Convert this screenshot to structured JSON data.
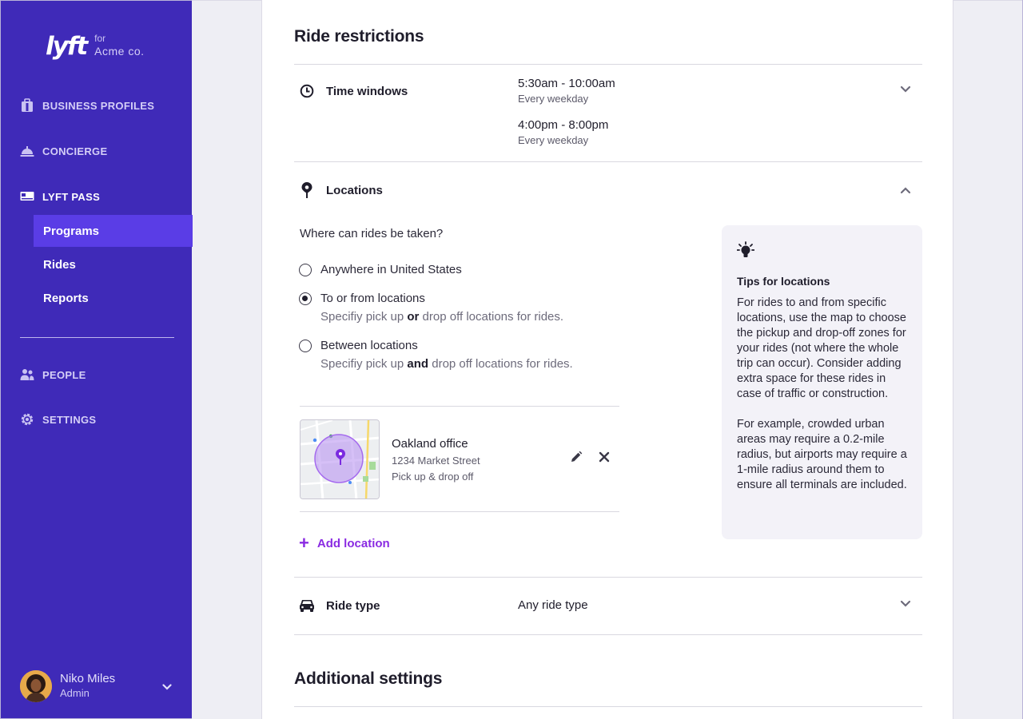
{
  "brand": {
    "logo": "lyft",
    "for": "for",
    "company": "Acme co."
  },
  "sidebar": {
    "items": [
      {
        "label": "BUSINESS PROFILES",
        "icon": "briefcase-icon"
      },
      {
        "label": "CONCIERGE",
        "icon": "bell-icon"
      },
      {
        "label": "LYFT PASS",
        "icon": "pass-icon"
      },
      {
        "label": "PEOPLE",
        "icon": "people-icon"
      },
      {
        "label": "SETTINGS",
        "icon": "gear-icon"
      }
    ],
    "subitems": [
      {
        "label": "Programs"
      },
      {
        "label": "Rides"
      },
      {
        "label": "Reports"
      }
    ]
  },
  "user": {
    "name": "Niko Miles",
    "role": "Admin"
  },
  "main": {
    "ride_restrictions_title": "Ride restrictions",
    "time_windows": {
      "label": "Time windows",
      "windows": [
        {
          "time": "5:30am - 10:00am",
          "freq": "Every weekday"
        },
        {
          "time": "4:00pm - 8:00pm",
          "freq": "Every weekday"
        }
      ]
    },
    "locations": {
      "label": "Locations",
      "question": "Where can rides be taken?",
      "options": [
        {
          "label": "Anywhere in United States",
          "sub_pre": "",
          "sub_bold": "",
          "sub_post": ""
        },
        {
          "label": "To or from locations",
          "sub_pre": "Specifiy pick up ",
          "sub_bold": "or",
          "sub_post": " drop off locations for rides."
        },
        {
          "label": "Between locations",
          "sub_pre": "Specifiy pick up ",
          "sub_bold": "and",
          "sub_post": " drop off locations for rides."
        }
      ],
      "selected_option": "To or from locations",
      "saved": {
        "name": "Oakland office",
        "address": "1234 Market Street",
        "type": "Pick up & drop off"
      },
      "add_label": "Add location"
    },
    "tips": {
      "title": "Tips for locations",
      "p1": "For rides to and from specific locations, use the map to choose the pickup and drop-off zones for your rides (not where the whole trip can occur). Consider adding extra space for these rides in case of traffic or construction.",
      "p2": "For example, crowded urban areas may require a 0.2-mile radius, but airports may require a 1-mile radius around them to ensure all terminals are included."
    },
    "ride_type": {
      "label": "Ride type",
      "value": "Any ride type"
    },
    "additional_title": "Additional settings"
  },
  "colors": {
    "sidebar": "#3F2AB8",
    "selected": "#5A3DE6",
    "accent": "#8A2BE2"
  }
}
